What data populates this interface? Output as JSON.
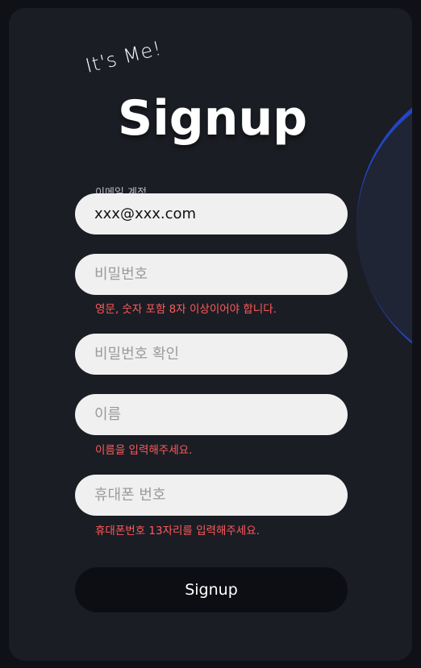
{
  "header": {
    "tagline": "It's Me!",
    "title": "Signup"
  },
  "form": {
    "email": {
      "label": "이메일 계정",
      "value": "xxx@xxx.com"
    },
    "password": {
      "placeholder": "비밀번호",
      "error": "영문, 숫자 포함 8자 이상이어야 합니다."
    },
    "password_confirm": {
      "placeholder": "비밀번호 확인"
    },
    "name": {
      "placeholder": "이름",
      "error": "이름을 입력해주세요."
    },
    "phone": {
      "placeholder": "휴대폰 번호",
      "error": "휴대폰번호 13자리를 입력해주세요."
    },
    "submit_label": "Signup"
  },
  "colors": {
    "card_bg": "#1b1d24",
    "input_bg": "#f0f0f0",
    "error": "#ff5a5a",
    "button_bg": "#0d0e13",
    "accent_ring": "#2346c2"
  }
}
